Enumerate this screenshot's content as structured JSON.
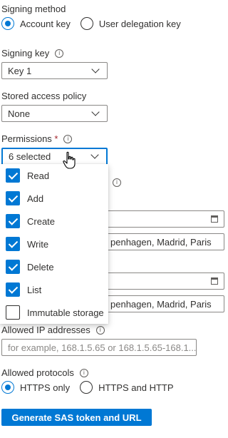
{
  "signing_method": {
    "label": "Signing method",
    "options": [
      {
        "label": "Account key",
        "selected": true
      },
      {
        "label": "User delegation key",
        "selected": false
      }
    ]
  },
  "signing_key": {
    "label": "Signing key",
    "value": "Key 1"
  },
  "stored_access_policy": {
    "label": "Stored access policy",
    "value": "None"
  },
  "permissions": {
    "label": "Permissions",
    "required_marker": "*",
    "value": "6 selected",
    "items": [
      {
        "label": "Read",
        "checked": true
      },
      {
        "label": "Add",
        "checked": true
      },
      {
        "label": "Create",
        "checked": true
      },
      {
        "label": "Write",
        "checked": true
      },
      {
        "label": "Delete",
        "checked": true
      },
      {
        "label": "List",
        "checked": true
      },
      {
        "label": "Immutable storage",
        "checked": false
      }
    ]
  },
  "start_timezone": {
    "value": "penhagen, Madrid, Paris"
  },
  "expiry_timezone": {
    "value": "penhagen, Madrid, Paris"
  },
  "allowed_ip": {
    "label": "Allowed IP addresses",
    "placeholder": "for example, 168.1.5.65 or 168.1.5.65-168.1...."
  },
  "allowed_protocols": {
    "label": "Allowed protocols",
    "options": [
      {
        "label": "HTTPS only",
        "selected": true
      },
      {
        "label": "HTTPS and HTTP",
        "selected": false
      }
    ]
  },
  "generate_button": {
    "label": "Generate SAS token and URL"
  },
  "colors": {
    "accent": "#0078d4",
    "text": "#323130",
    "border": "#8a8886",
    "required": "#a4262c"
  },
  "icons": {
    "info": "info-circle-icon",
    "calendar": "calendar-icon",
    "chevron": "chevron-down-icon",
    "cursor": "hand-pointer-cursor-icon"
  }
}
